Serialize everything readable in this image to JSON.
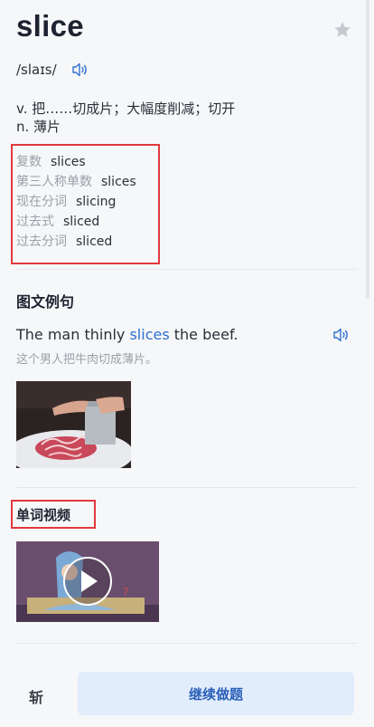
{
  "word": "slice",
  "phonetic": "/slaɪs/",
  "definitions": [
    "v. 把……切成片；大幅度削减；切开",
    "n. 薄片"
  ],
  "forms": [
    {
      "label": "复数",
      "value": "slices"
    },
    {
      "label": "第三人称单数",
      "value": "slices"
    },
    {
      "label": "现在分词",
      "value": "slicing"
    },
    {
      "label": "过去式",
      "value": "sliced"
    },
    {
      "label": "过去分词",
      "value": "sliced"
    }
  ],
  "example_section": {
    "title": "图文例句",
    "sentence_before": "The man thinly ",
    "sentence_highlight": "slices",
    "sentence_after": " the beef.",
    "translation": "这个男人把牛肉切成薄片。"
  },
  "video_section": {
    "title": "单词视频"
  },
  "bottom_bar": {
    "cut_label": "斩",
    "continue_label": "继续做题"
  },
  "colors": {
    "accent": "#2f6fd1",
    "highlight_box": "#e0393e",
    "button_bg": "#e2edfc"
  },
  "icons": [
    "star-icon",
    "speaker-icon",
    "play-icon"
  ]
}
